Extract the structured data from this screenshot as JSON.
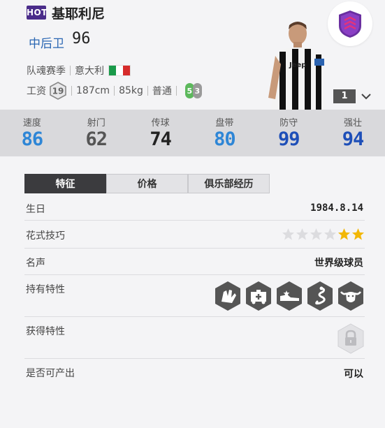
{
  "player": {
    "badge": "HOT",
    "name": "基耶利尼",
    "position": "中后卫",
    "overall": "96",
    "season": "队魂赛季",
    "nationality": "意大利",
    "wage_label": "工资",
    "wage": "19",
    "height": "187cm",
    "weight": "85kg",
    "body_type": "普通",
    "weak_foot": "5",
    "skill_foot": "3",
    "level": "1"
  },
  "colors": {
    "hot_badge": "#4a2c8a",
    "position_blue": "#2a66b3",
    "stat_blue": "#2e86d6",
    "stat_dark_blue": "#1e4fb8",
    "stat_gray": "#555555",
    "stat_black": "#222222",
    "foot_green": "#5cb85c",
    "foot_gray": "#9a9a9a",
    "star_gold": "#f2b705",
    "tab_active": "#3b3b3e"
  },
  "stats": [
    {
      "label": "速度",
      "value": "86",
      "color": "#2e86d6"
    },
    {
      "label": "射门",
      "value": "62",
      "color": "#555555"
    },
    {
      "label": "传球",
      "value": "74",
      "color": "#222222"
    },
    {
      "label": "盘带",
      "value": "80",
      "color": "#2e86d6"
    },
    {
      "label": "防守",
      "value": "99",
      "color": "#1e4fb8"
    },
    {
      "label": "强壮",
      "value": "94",
      "color": "#1e4fb8"
    }
  ],
  "tabs": [
    "特征",
    "价格",
    "俱乐部经历"
  ],
  "details": {
    "birthday_label": "生日",
    "birthday": "1984.8.14",
    "skill_label": "花式技巧",
    "skill_stars": 2,
    "skill_max": 6,
    "reputation_label": "名声",
    "reputation": "世界级球员",
    "traits_label": "持有特性",
    "traits": [
      "glove-icon",
      "ambulance-icon",
      "boot-star-icon",
      "snake-icon",
      "bull-icon"
    ],
    "acquired_label": "获得特性",
    "producible_label": "是否可产出",
    "producible": "可以"
  }
}
